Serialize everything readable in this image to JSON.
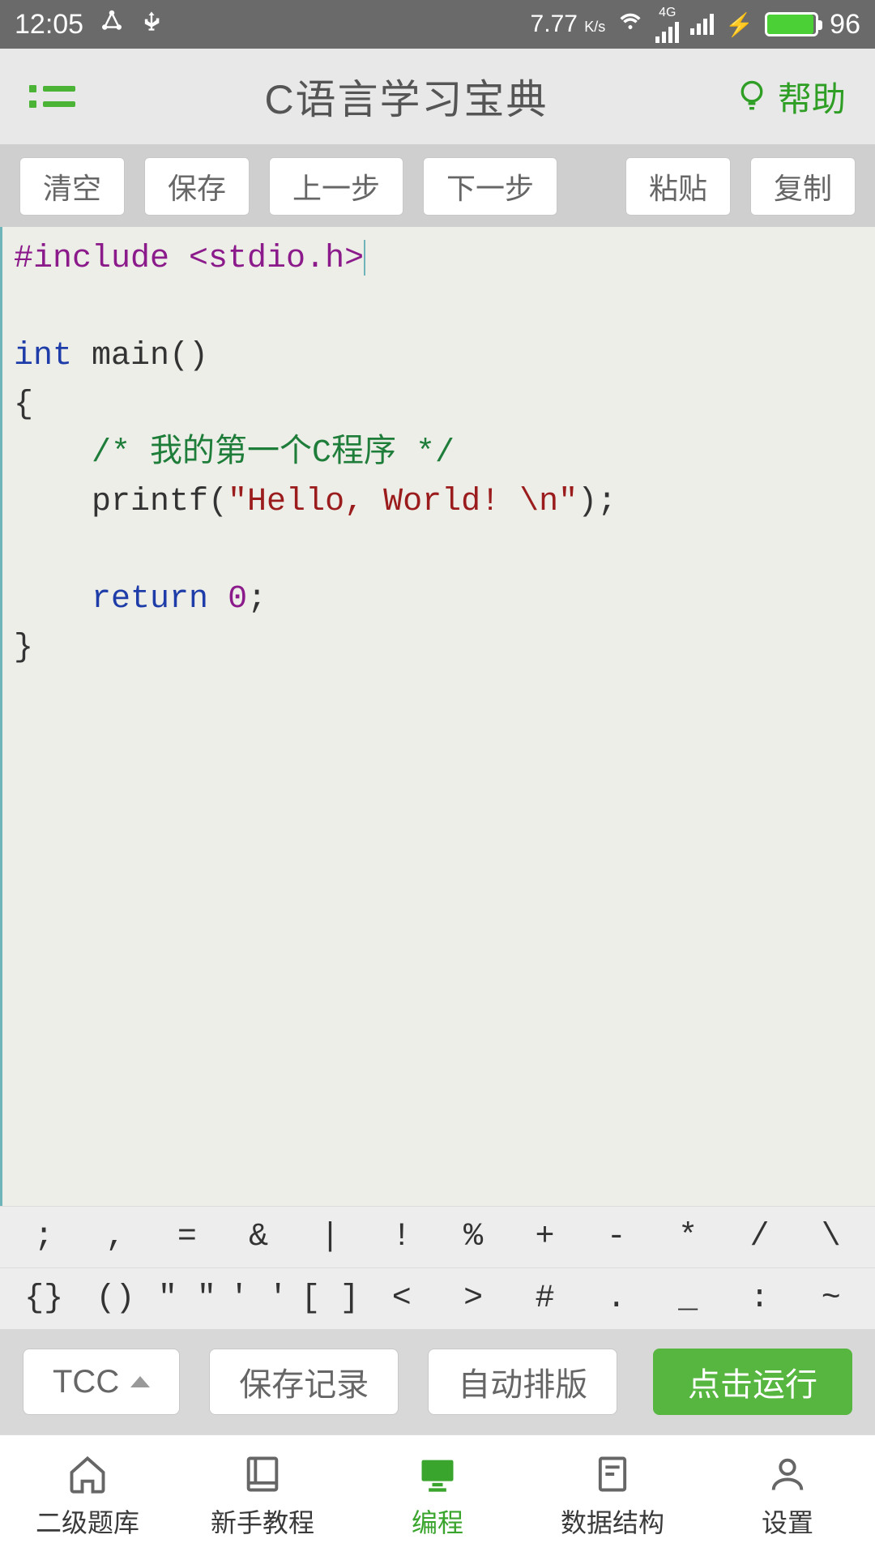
{
  "status": {
    "time": "12:05",
    "speed_text": "7.77",
    "speed_unit": "K/s",
    "net_label": "4G",
    "battery_pct": "96"
  },
  "header": {
    "title": "C语言学习宝典",
    "help_label": "帮助"
  },
  "toolbar": {
    "clear": "清空",
    "save": "保存",
    "undo": "上一步",
    "redo": "下一步",
    "paste": "粘贴",
    "copy": "复制"
  },
  "code": {
    "line1_pre": "#include <stdio.h>",
    "line3_kw": "int",
    "line3_rest": " main()",
    "line4": "{",
    "line5_indent": "    ",
    "line5_cm": "/* 我的第一个C程序 */",
    "line6_indent": "    ",
    "line6_printf": "printf(",
    "line6_str": "\"Hello, World! \\n\"",
    "line6_end": ");",
    "line8_indent": "    ",
    "line8_kw": "return",
    "line8_sp": " ",
    "line8_num": "0",
    "line8_end": ";",
    "line9": "}"
  },
  "symbols": {
    "row1": [
      ";",
      ",",
      "=",
      "&",
      "|",
      "!",
      "%",
      "+",
      "-",
      "*",
      "/",
      "\\"
    ],
    "row2": [
      "{}",
      "()",
      "\" \"",
      "' '",
      "[ ]",
      "<",
      ">",
      "#",
      ".",
      "_",
      ":",
      "~"
    ]
  },
  "runbar": {
    "compiler": "TCC",
    "save_record": "保存记录",
    "auto_format": "自动排版",
    "run": "点击运行"
  },
  "nav": {
    "items": [
      {
        "label": "二级题库"
      },
      {
        "label": "新手教程"
      },
      {
        "label": "编程"
      },
      {
        "label": "数据结构"
      },
      {
        "label": "设置"
      }
    ]
  }
}
